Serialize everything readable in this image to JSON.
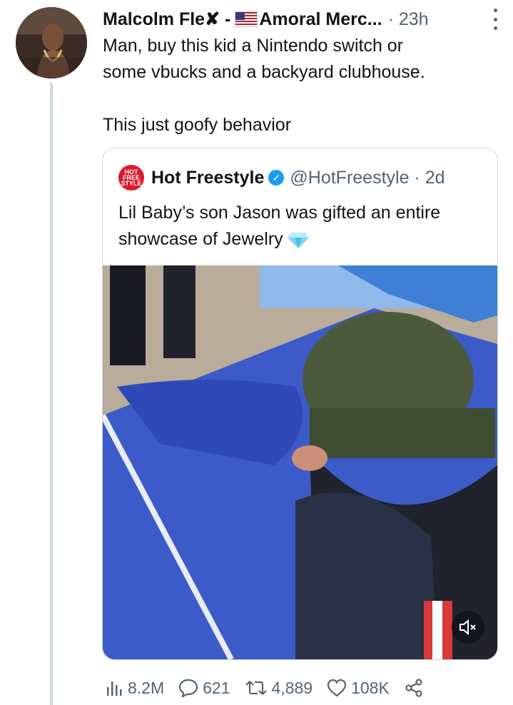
{
  "tweet": {
    "author_name": "Malcolm Fle✘ - ",
    "author_name_suffix": "Amoral Merc...",
    "time": "· 23h",
    "lines": [
      "Man, buy this kid a Nintendo switch or",
      "some vbucks and a backyard clubhouse.",
      "This just goofy behavior"
    ]
  },
  "quote": {
    "avatar_text": [
      "HOT",
      "FREE",
      "STYLE"
    ],
    "name": "Hot Freestyle",
    "handle": "@HotFreestyle · 2d",
    "lines": [
      "Lil Baby’s son Jason was gifted an entire",
      "showcase of Jewelry"
    ]
  },
  "actions": {
    "views": "8.2M",
    "replies": "621",
    "retweets": "4,889",
    "likes": "108K"
  },
  "colors": {
    "accent": "#1d9bf0",
    "muted": "#536471",
    "border": "#cfd9de",
    "hot_freestyle_red": "#e0162b"
  },
  "icons": [
    "more-icon",
    "verified-icon",
    "gem-icon",
    "mute-icon",
    "views-icon",
    "reply-icon",
    "retweet-icon",
    "like-icon",
    "share-icon"
  ]
}
